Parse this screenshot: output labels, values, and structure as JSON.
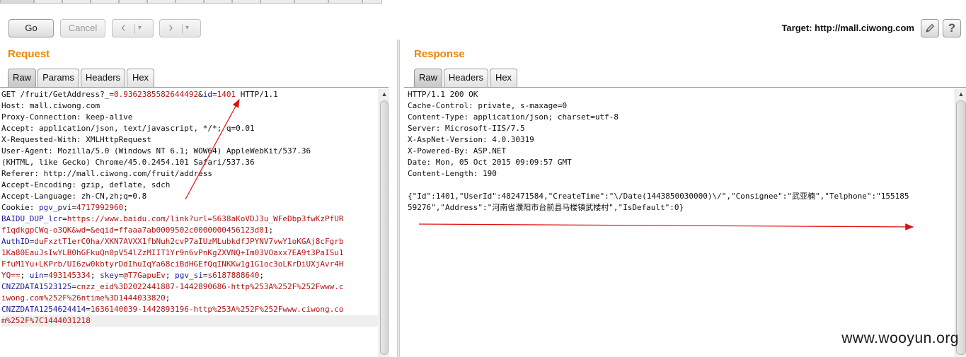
{
  "toolbar": {
    "go_label": "Go",
    "cancel_label": "Cancel",
    "back_icon": "chevron-left-icon",
    "forward_icon": "chevron-right-icon",
    "target_label": "Target: http://mall.ciwong.com",
    "edit_icon": "pencil-icon",
    "help_label": "?"
  },
  "request": {
    "title": "Request",
    "tabs": [
      "Raw",
      "Params",
      "Headers",
      "Hex"
    ],
    "active_tab": "Raw",
    "lines": [
      [
        [
          "GET /fruit/GetAddress?_=",
          ""
        ],
        [
          "0.9362385582644492",
          "v"
        ],
        [
          "&",
          ""
        ],
        [
          "id",
          "k"
        ],
        [
          "=",
          ""
        ],
        [
          "1401",
          "v"
        ],
        [
          " HTTP/1.1",
          ""
        ]
      ],
      [
        [
          "Host: mall.ciwong.com",
          ""
        ]
      ],
      [
        [
          "Proxy-Connection: keep-alive",
          ""
        ]
      ],
      [
        [
          "Accept: application/json, text/javascript, */*; q=0.01",
          ""
        ]
      ],
      [
        [
          "X-Requested-With: XMLHttpRequest",
          ""
        ]
      ],
      [
        [
          "User-Agent: Mozilla/5.0 (Windows NT 6.1; WOW64) AppleWebKit/537.36",
          ""
        ]
      ],
      [
        [
          "(KHTML, like Gecko) Chrome/45.0.2454.101 Safari/537.36",
          ""
        ]
      ],
      [
        [
          "Referer: http://mall.ciwong.com/fruit/address",
          ""
        ]
      ],
      [
        [
          "Accept-Encoding: gzip, deflate, sdch",
          ""
        ]
      ],
      [
        [
          "Accept-Language: zh-CN,zh;q=0.8",
          ""
        ]
      ],
      [
        [
          "Cookie: ",
          ""
        ],
        [
          "pgv_pvi",
          "k"
        ],
        [
          "=",
          ""
        ],
        [
          "4717992960",
          "v"
        ],
        [
          ";",
          ""
        ]
      ],
      [
        [
          "BAIDU_DUP_lcr",
          "k"
        ],
        [
          "=",
          ""
        ],
        [
          "https://www.baidu.com/link?url=S638aKoVDJ3u_WFeDbp3fwKzPfUR",
          "v"
        ]
      ],
      [
        [
          "f1qdkgpCWq-o3QK&wd=&eqid=ffaaa7ab0009502c0000000456123d01",
          "v"
        ],
        [
          ";",
          ""
        ]
      ],
      [
        [
          "AuthID",
          "k"
        ],
        [
          "=",
          ""
        ],
        [
          "duFxztT1erC0ha/XKN7AVXX1fbNuh2cvP7aIUzMLubkdfJPYNV7vwY1oKGAj8cFgrb",
          "v"
        ]
      ],
      [
        [
          "1Ka80EauJsIwYLB0hGFkuQn0pV54lZzMIIT1Yr9n6vPnKgZXVNQ+Im03VOaxx7EA9t3PaISu1",
          "v"
        ]
      ],
      [
        [
          "FfuM1Yu+LKPrb/UI6zw0kbtyrDdIhuIqYa68ciBdHGEfQqINKKw1g1G1oc3oLKrDiUXjAvr4H",
          "v"
        ]
      ],
      [
        [
          "YQ==",
          "v"
        ],
        [
          "; ",
          ""
        ],
        [
          "uin",
          "k"
        ],
        [
          "=",
          ""
        ],
        [
          "493145334",
          "v"
        ],
        [
          "; ",
          ""
        ],
        [
          "skey",
          "k"
        ],
        [
          "=",
          ""
        ],
        [
          "@T7GapuEv",
          "v"
        ],
        [
          "; ",
          ""
        ],
        [
          "pgv_si",
          "k"
        ],
        [
          "=",
          ""
        ],
        [
          "s6187888640",
          "v"
        ],
        [
          ";",
          ""
        ]
      ],
      [
        [
          "CNZZDATA1523125",
          "k"
        ],
        [
          "=",
          ""
        ],
        [
          "cnzz_eid%3D2022441887-1442890686-http%253A%252F%252Fwww.c",
          "v"
        ]
      ],
      [
        [
          "iwong.com%252F%26ntime%3D1444033820",
          "v"
        ],
        [
          ";",
          ""
        ]
      ],
      [
        [
          "CNZZDATA1254624414",
          "k"
        ],
        [
          "=",
          ""
        ],
        [
          "1636140039-1442893196-http%253A%252F%252Fwww.ciwong.co",
          "v"
        ]
      ],
      [
        [
          "m%252F%7C1444031218",
          "v"
        ]
      ]
    ]
  },
  "response": {
    "title": "Response",
    "tabs": [
      "Raw",
      "Headers",
      "Hex"
    ],
    "active_tab": "Raw",
    "lines": [
      "HTTP/1.1 200 OK",
      "Cache-Control: private, s-maxage=0",
      "Content-Type: application/json; charset=utf-8",
      "Server: Microsoft-IIS/7.5",
      "X-AspNet-Version: 4.0.30319",
      "X-Powered-By: ASP.NET",
      "Date: Mon, 05 Oct 2015 09:09:57 GMT",
      "Content-Length: 190",
      "",
      "{\"Id\":1401,\"UserId\":482471584,\"CreateTime\":\"\\/Date(1443850030000)\\/\",\"Consignee\":\"武亚楠\",\"Telphone\":\"155185",
      "59276\",\"Address\":\"河南省濮阳市台前县马楼镇武楼村\",\"IsDefault\":0}"
    ]
  },
  "watermark": "www.wooyun.org",
  "colors": {
    "accent": "#e8860b",
    "param_name": "#1a1a9e",
    "param_value": "#b01515",
    "annotation_arrow": "#e01010"
  }
}
